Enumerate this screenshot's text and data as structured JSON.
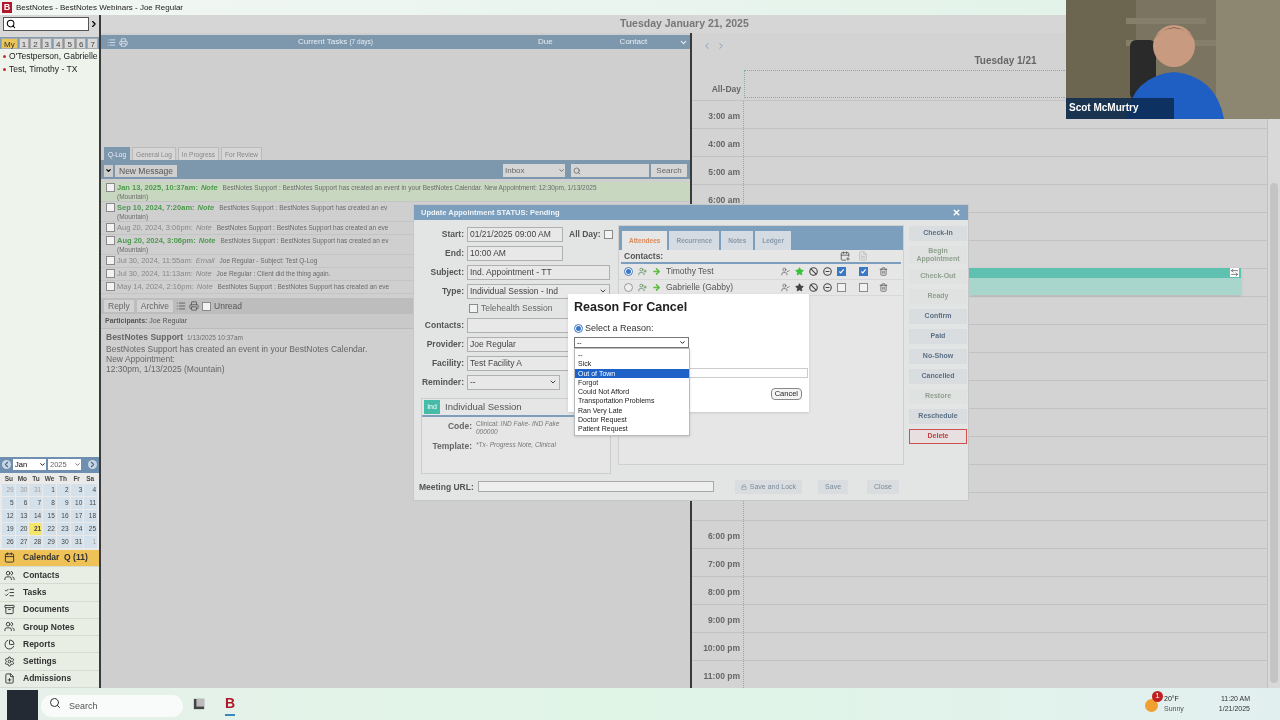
{
  "title_bar": {
    "logo": "B",
    "title": "BestNotes - BestNotes Webinars - Joe Regular"
  },
  "header": {
    "date": "Tuesday January 21, 2025"
  },
  "sidebar": {
    "tabs": [
      {
        "label": "My",
        "selected": true
      },
      {
        "label": "1",
        "selected": false
      },
      {
        "label": "2",
        "selected": false
      },
      {
        "label": "3",
        "selected": false
      },
      {
        "label": "4",
        "selected": false
      },
      {
        "label": "5",
        "selected": false
      },
      {
        "label": "6",
        "selected": false
      },
      {
        "label": "7",
        "selected": false
      }
    ],
    "patients": [
      "O'Testperson, Gabrielle",
      "Test, Timothy - TX"
    ],
    "mini_calendar": {
      "month": "Jan",
      "year": "2025",
      "weekdays": [
        "Su",
        "Mo",
        "Tu",
        "We",
        "Th",
        "Fr",
        "Sa"
      ],
      "weeks": [
        [
          {
            "label": "29",
            "outside": true,
            "selected": false
          },
          {
            "label": "30",
            "outside": true,
            "selected": false
          },
          {
            "label": "31",
            "outside": true,
            "selected": false
          },
          {
            "label": "1",
            "outside": false,
            "selected": false
          },
          {
            "label": "2",
            "outside": false,
            "selected": false
          },
          {
            "label": "3",
            "outside": false,
            "selected": false
          },
          {
            "label": "4",
            "outside": false,
            "selected": false
          }
        ],
        [
          {
            "label": "5",
            "outside": false,
            "selected": false
          },
          {
            "label": "6",
            "outside": false,
            "selected": false
          },
          {
            "label": "7",
            "outside": false,
            "selected": false
          },
          {
            "label": "8",
            "outside": false,
            "selected": false
          },
          {
            "label": "9",
            "outside": false,
            "selected": false
          },
          {
            "label": "10",
            "outside": false,
            "selected": false
          },
          {
            "label": "11",
            "outside": false,
            "selected": false
          }
        ],
        [
          {
            "label": "12",
            "outside": false,
            "selected": false
          },
          {
            "label": "13",
            "outside": false,
            "selected": false
          },
          {
            "label": "14",
            "outside": false,
            "selected": false
          },
          {
            "label": "15",
            "outside": false,
            "selected": false
          },
          {
            "label": "16",
            "outside": false,
            "selected": false
          },
          {
            "label": "17",
            "outside": false,
            "selected": false
          },
          {
            "label": "18",
            "outside": false,
            "selected": false
          }
        ],
        [
          {
            "label": "19",
            "outside": false,
            "selected": false
          },
          {
            "label": "20",
            "outside": false,
            "selected": false
          },
          {
            "label": "21",
            "outside": false,
            "selected": true
          },
          {
            "label": "22",
            "outside": false,
            "selected": false
          },
          {
            "label": "23",
            "outside": false,
            "selected": false
          },
          {
            "label": "24",
            "outside": false,
            "selected": false
          },
          {
            "label": "25",
            "outside": false,
            "selected": false
          }
        ],
        [
          {
            "label": "26",
            "outside": false,
            "selected": false
          },
          {
            "label": "27",
            "outside": false,
            "selected": false
          },
          {
            "label": "28",
            "outside": false,
            "selected": false
          },
          {
            "label": "29",
            "outside": false,
            "selected": false
          },
          {
            "label": "30",
            "outside": false,
            "selected": false
          },
          {
            "label": "31",
            "outside": false,
            "selected": false
          },
          {
            "label": "1",
            "outside": true,
            "selected": false
          }
        ]
      ]
    },
    "nav": [
      {
        "label": "Calendar  Q (11)",
        "selected": true
      },
      {
        "label": "Contacts",
        "selected": false
      },
      {
        "label": "Tasks",
        "selected": false
      },
      {
        "label": "Documents",
        "selected": false
      },
      {
        "label": "Group Notes",
        "selected": false
      },
      {
        "label": "Reports",
        "selected": false
      },
      {
        "label": "Settings",
        "selected": false
      },
      {
        "label": "Admissions",
        "selected": false
      }
    ]
  },
  "tasks_panel": {
    "title": "Current Tasks",
    "subtitle": "(7 days)",
    "columns": [
      "Due",
      "Contact"
    ]
  },
  "qlog": {
    "tabs": [
      {
        "label": "Q-Log",
        "selected": true
      },
      {
        "label": "General Log",
        "selected": false
      },
      {
        "label": "In Progress",
        "selected": false
      },
      {
        "label": "For Review",
        "selected": false
      }
    ],
    "new_message": "New Message",
    "folder": "Inbox",
    "search_button": "Search",
    "messages": [
      {
        "date": "Jan 13, 2025, 10:37am:",
        "type": "Note",
        "preview": "BestNotes Support : BestNotes Support has created an event in your BestNotes Calendar. New Appointment: 12:30pm, 1/13/2025",
        "preview_2": "(Mountain)",
        "unread": true,
        "selected": true,
        "checked": false
      },
      {
        "date": "Sep 10, 2024, 7:20am:",
        "type": "Note",
        "preview": "BestNotes Support : BestNotes Support has created an ev",
        "preview_2": "(Mountain)",
        "unread": true,
        "selected": false,
        "checked": false
      },
      {
        "date": "Aug 20, 2024, 3:06pm:",
        "type": "Note",
        "preview": "BestNotes Support : BestNotes Support has created an eve",
        "unread": false,
        "selected": false,
        "checked": false
      },
      {
        "date": "Aug 20, 2024, 3:06pm:",
        "type": "Note",
        "preview": "BestNotes Support : BestNotes Support has created an ev",
        "preview_2": "(Mountain)",
        "unread": true,
        "selected": false,
        "checked": false
      },
      {
        "date": "Jul 30, 2024, 11:55am:",
        "type": "Email",
        "preview": "Joe Regular - Subject: Test Q-Log",
        "unread": false,
        "selected": false,
        "checked": false
      },
      {
        "date": "Jul 30, 2024, 11:13am:",
        "type": "Note",
        "preview": "Joe Regular : Client did the thing again.",
        "unread": false,
        "selected": false,
        "checked": false
      },
      {
        "date": "May 14, 2024, 2:16pm:",
        "type": "Note",
        "preview": "BestNotes Support : BestNotes Support has created an eve",
        "unread": false,
        "selected": false,
        "checked": false
      }
    ],
    "reply": "Reply",
    "archive": "Archive",
    "unread_label": "Unread",
    "unread_checked": false,
    "participants": "**Participants:** Joe Regular",
    "body": {
      "sender": "BestNotes Support",
      "time": "1/13/2025 10:37am",
      "lines": [
        "BestNotes Support has created an event in your BestNotes Calendar.",
        "New Appointment:",
        "12:30pm, 1/13/2025 (Mountain)"
      ]
    }
  },
  "calendar": {
    "day_title": "Tuesday 1/21",
    "all_day": "All-Day",
    "hours_morning": [
      "3:00 am",
      "4:00 am",
      "5:00 am",
      "6:00 am"
    ],
    "hours_evening": [
      "6:00 pm",
      "7:00 pm",
      "8:00 pm",
      "9:00 pm",
      "10:00 pm",
      "11:00 pm"
    ]
  },
  "video": {
    "name": "Scot McMurtry"
  },
  "dialog": {
    "title": "Update Appointment STATUS: Pending",
    "start": {
      "label": "Start:",
      "value": "01/21/2025 09:00 AM"
    },
    "all_day": {
      "label": "All Day:",
      "checked": false
    },
    "end": {
      "label": "End:",
      "value": "10:00 AM"
    },
    "subject": {
      "label": "Subject:",
      "value": "Ind. Appointment - TT"
    },
    "type": {
      "label": "Type:",
      "value": "Individual Session - Ind"
    },
    "telehealth": {
      "label": "Telehealth Session",
      "checked": false
    },
    "contacts": {
      "label": "Contacts:"
    },
    "provider": {
      "label": "Provider:",
      "value": "Joe Regular"
    },
    "facility": {
      "label": "Facility:",
      "value": "Test Facility A"
    },
    "reminder": {
      "label": "Reminder:",
      "value": "--"
    },
    "session": {
      "badge": "Ind",
      "title": "Individual Session",
      "code_label": "Code:",
      "code_prefix": "Clinical:",
      "code": "IND Fake- IND Fake",
      "code_2": "000000",
      "template_label": "Template:",
      "template": "*Tx- Progress Note, Clinical"
    },
    "tabs": [
      {
        "label": "Attendees",
        "selected": true
      },
      {
        "label": "Recurrence",
        "selected": false
      },
      {
        "label": "Notes",
        "selected": false
      },
      {
        "label": "Ledger",
        "selected": false
      }
    ],
    "contacts_label": "Contacts:",
    "attendees": [
      {
        "name": "Timothy Test",
        "selected": true,
        "starred": true,
        "check_1": true,
        "check_2": true
      },
      {
        "name": "Gabrielle (Gabby)",
        "selected": false,
        "starred": false,
        "check_1": false,
        "check_2": false
      }
    ],
    "actions": [
      {
        "label": "Check-In",
        "disabled": false,
        "kind": "normal"
      },
      {
        "label": "Begin Appointment",
        "disabled": true,
        "kind": "normal"
      },
      {
        "label": "Check-Out",
        "disabled": true,
        "kind": "normal"
      },
      {
        "label": "Ready",
        "disabled": true,
        "kind": "normal"
      },
      {
        "label": "Confirm",
        "disabled": false,
        "kind": "normal"
      },
      {
        "label": "Paid",
        "disabled": false,
        "kind": "normal"
      },
      {
        "label": "No-Show",
        "disabled": false,
        "kind": "normal"
      },
      {
        "label": "Cancelled",
        "disabled": false,
        "kind": "normal"
      },
      {
        "label": "Restore",
        "disabled": true,
        "kind": "normal"
      },
      {
        "label": "Reschedule",
        "disabled": false,
        "kind": "normal"
      },
      {
        "label": "Delete",
        "disabled": false,
        "kind": "danger"
      }
    ],
    "meeting_url_label": "Meeting URL:",
    "save_lock": "Save and Lock",
    "save": "Save",
    "close": "Close"
  },
  "cancel_popup": {
    "title": "Reason For Cancel",
    "option_label": "Select a Reason:",
    "option_selected": true,
    "select_value": "--",
    "cancel": "Cancel",
    "options": [
      {
        "label": "--",
        "selected": false
      },
      {
        "label": "Sick",
        "selected": false
      },
      {
        "label": "Out of Town",
        "selected": true
      },
      {
        "label": "Forgot",
        "selected": false
      },
      {
        "label": "Could Not Afford",
        "selected": false
      },
      {
        "label": "Transportation Problems",
        "selected": false
      },
      {
        "label": "Ran Very Late",
        "selected": false
      },
      {
        "label": "Doctor Request",
        "selected": false
      },
      {
        "label": "Patient Request",
        "selected": false
      }
    ]
  },
  "taskbar": {
    "search_placeholder": "Search",
    "app": "B",
    "weather": {
      "badge": "1",
      "temp": "20°F",
      "condition": "Sunny"
    },
    "clock": {
      "time": "11:20 AM",
      "date": "1/21/2025"
    }
  }
}
